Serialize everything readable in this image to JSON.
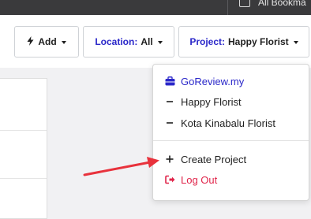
{
  "browser": {
    "bookmarks_label": "All Bookma"
  },
  "toolbar": {
    "add_label": "Add",
    "location_label": "Location:",
    "location_value": "All",
    "project_label": "Project:",
    "project_value": "Happy Florist"
  },
  "menu": {
    "items": [
      {
        "label": "GoReview.my",
        "icon": "briefcase-icon"
      },
      {
        "label": "Happy Florist",
        "icon": "dash-icon"
      },
      {
        "label": "Kota Kinabalu Florist",
        "icon": "dash-icon"
      },
      {
        "label": "Create Project",
        "icon": "plus-icon"
      },
      {
        "label": "Log Out",
        "icon": "logout-icon"
      }
    ]
  },
  "colors": {
    "accent": "#2a27c9",
    "danger": "#e0244a",
    "annotation_arrow": "#e8323c"
  }
}
